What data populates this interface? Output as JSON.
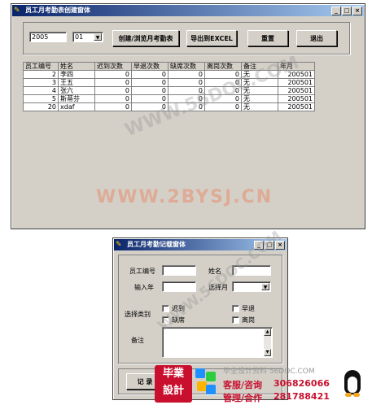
{
  "window1": {
    "title": "员工月考勤表创建窗体",
    "year_value": "2005",
    "month_value": "01",
    "buttons": {
      "create": "创建/浏览月考勤表",
      "export": "导出到EXCEL",
      "reset": "重置",
      "exit": "退出"
    },
    "table": {
      "headers": [
        "员工编号",
        "姓名",
        "迟到次数",
        "早退次数",
        "缺席次数",
        "离岗次数",
        "备注",
        "年月"
      ],
      "rows": [
        [
          "2",
          "李四",
          "0",
          "0",
          "0",
          "0",
          "无",
          "200501"
        ],
        [
          "3",
          "王五",
          "0",
          "0",
          "0",
          "0",
          "无",
          "200501"
        ],
        [
          "4",
          "张六",
          "0",
          "0",
          "0",
          "0",
          "无",
          "200501"
        ],
        [
          "5",
          "斯蒂芬",
          "0",
          "0",
          "0",
          "0",
          "无",
          "200501"
        ],
        [
          "20",
          "xdaf",
          "0",
          "0",
          "0",
          "0",
          "无",
          "200501"
        ]
      ]
    }
  },
  "window2": {
    "title": "员工月考勤记载窗体",
    "labels": {
      "emp_id": "员工编号",
      "name": "姓名",
      "year": "输入年",
      "month": "选择月",
      "category": "选择类别",
      "remark": "备注"
    },
    "checkboxes": {
      "late": "迟到",
      "early": "早退",
      "absent": "缺席",
      "leave": "离岗"
    },
    "button_partial": "记 录"
  },
  "watermarks": {
    "w1": "WWW.56DOC.COM",
    "w2": "WWW.2BYSJ.CN",
    "w3": "WWW.56DOC.COM"
  },
  "banner": {
    "logo_line1": "毕業",
    "logo_line2": "設計",
    "site": "毕业设计资料 56DOC.COM",
    "kefu_label": "客服/咨询",
    "kefu_qq": "306826066",
    "manage_label": "管理/合作",
    "manage_qq": "281788421"
  },
  "colors": {
    "face": "#d4d0c8",
    "title_start": "#0a246a",
    "title_end": "#a6caf0"
  }
}
